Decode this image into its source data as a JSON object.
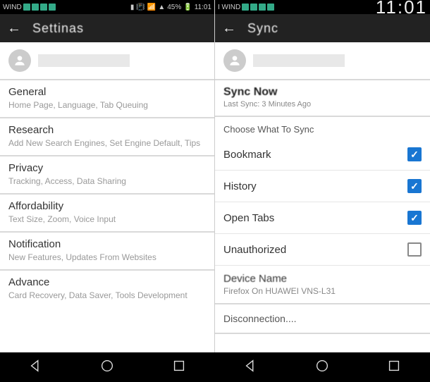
{
  "left": {
    "status": {
      "carrier": "WIND",
      "battery": "45%",
      "time": "11:01"
    },
    "app_title": "Settinas",
    "sections": [
      {
        "title": "General",
        "sub": "Home Page, Language, Tab Queuing"
      },
      {
        "title": "Research",
        "sub": "Add New Search Engines, Set Engine Default, Tips"
      },
      {
        "title": "Privacy",
        "sub": "Tracking, Access, Data Sharing"
      },
      {
        "title": "Affordability",
        "sub": "Text Size, Zoom, Voice Input"
      },
      {
        "title": "Notification",
        "sub": "New Features, Updates From Websites"
      },
      {
        "title": "Advance",
        "sub": "Card Recovery, Data Saver, Tools Development"
      }
    ]
  },
  "right": {
    "status": {
      "carrier": "I WIND",
      "time": "11:01"
    },
    "app_title": "Sync",
    "sync_now": "Sync Now",
    "last_sync": "Last Sync: 3 Minutes Ago",
    "choose_label": "Choose What To Sync",
    "items": [
      {
        "label": "Bookmark",
        "checked": true
      },
      {
        "label": "History",
        "checked": true
      },
      {
        "label": "Open Tabs",
        "checked": true
      },
      {
        "label": "Unauthorized",
        "checked": false
      }
    ],
    "device_title": "Device Name",
    "device_sub": "Firefox On HUAWEI VNS-L31",
    "disconnect": "Disconnection...."
  }
}
